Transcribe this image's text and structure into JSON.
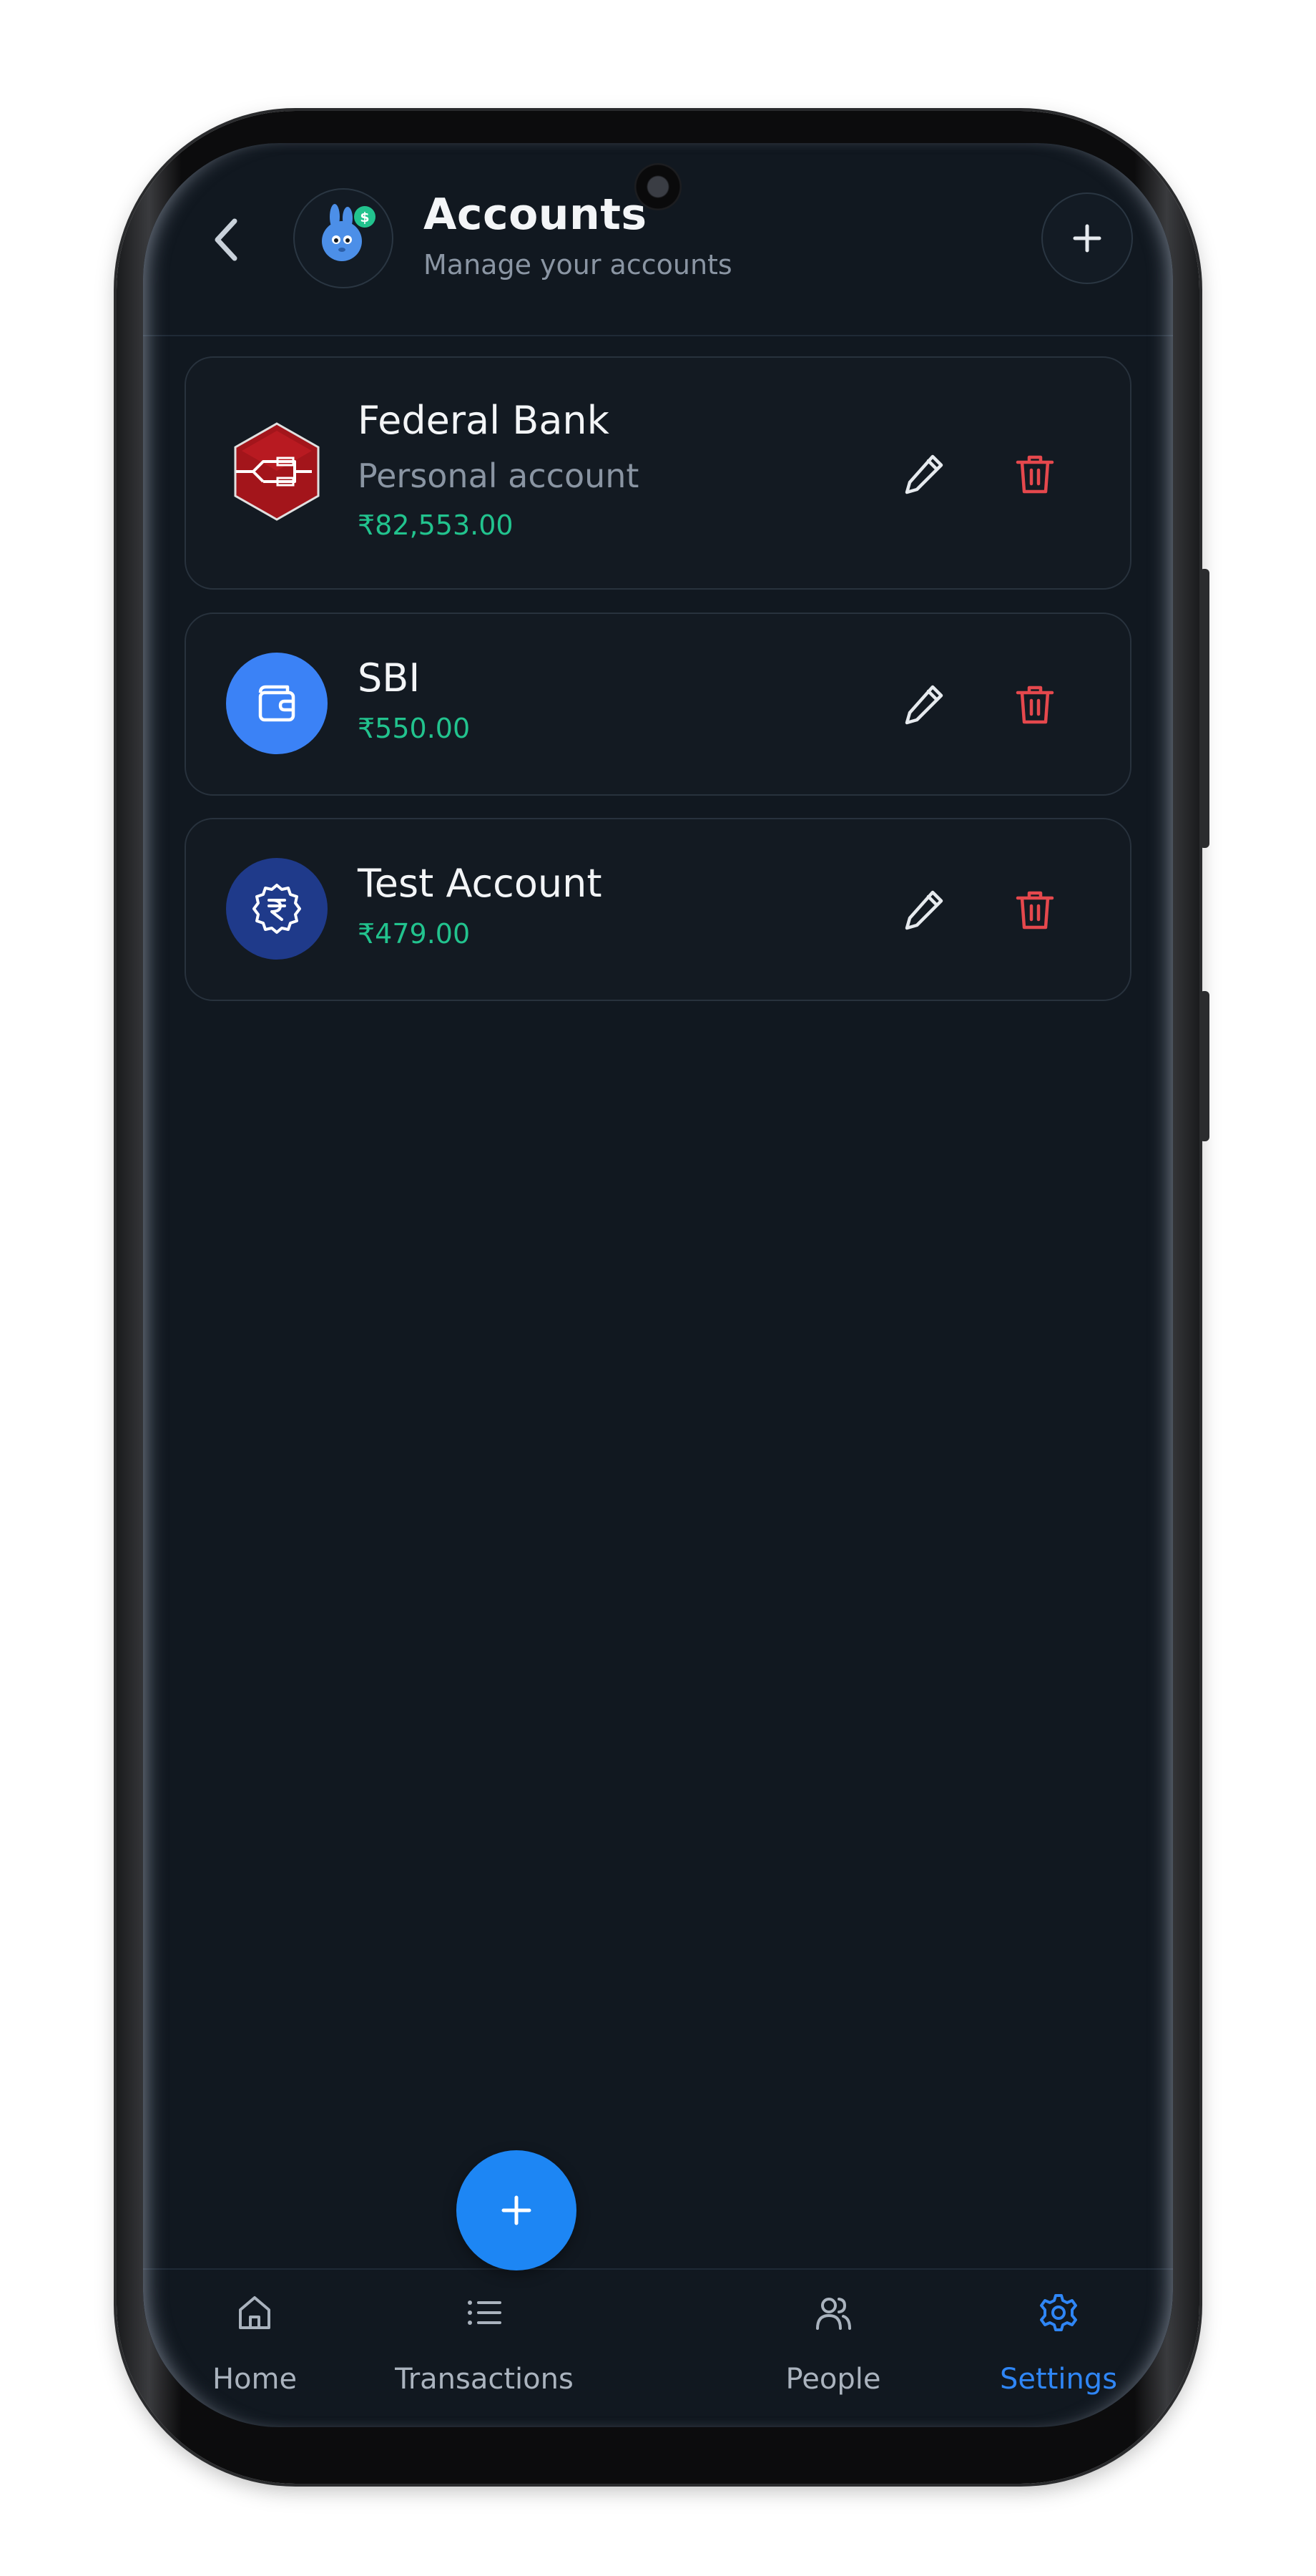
{
  "header": {
    "title": "Accounts",
    "subtitle": "Manage your accounts",
    "back_icon": "chevron-left-icon",
    "add_icon": "plus-icon"
  },
  "accounts": [
    {
      "name": "Federal Bank",
      "type": "Personal account",
      "balance": "₹82,553.00",
      "icon": "federal-bank-logo",
      "icon_color": "#a3151b"
    },
    {
      "name": "SBI",
      "balance": "₹550.00",
      "icon": "wallet-icon",
      "icon_color": "#3b82f6"
    },
    {
      "name": "Test Account",
      "balance": "₹479.00",
      "icon": "rupee-badge-icon",
      "icon_color": "#1f3a8a"
    }
  ],
  "nav": {
    "items": [
      {
        "label": "Home",
        "icon": "home-icon"
      },
      {
        "label": "Transactions",
        "icon": "list-icon"
      },
      {
        "label": "People",
        "icon": "people-icon"
      },
      {
        "label": "Settings",
        "icon": "gear-icon",
        "active": true
      }
    ],
    "fab_icon": "plus-icon"
  },
  "colors": {
    "background": "#111820",
    "card": "#131a22",
    "accent": "#1d86f4",
    "balance": "#22c38e",
    "delete": "#e5484d"
  }
}
